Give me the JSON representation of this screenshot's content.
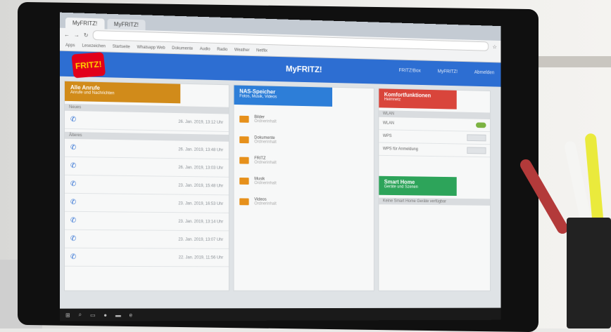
{
  "browser": {
    "tabs": [
      "MyFRITZ!",
      "MyFRITZ!"
    ],
    "bookmarks": [
      "Apps",
      "Lesezeichen",
      "Startseite",
      "Whatsapp Web",
      "Dokumente",
      "Audio",
      "Radio",
      "Weather",
      "Netflix"
    ]
  },
  "header": {
    "logo_text": "FRITZ!",
    "title": "MyFRITZ!",
    "nav": [
      "FRITZ!Box",
      "MyFRITZ!",
      "Abmelden"
    ]
  },
  "calls": {
    "title": "Alle Anrufe",
    "subtitle": "Anrufe und Nachrichten",
    "section_new": "Neues",
    "section_old": "Älteres",
    "items": [
      {
        "date": "26. Jan. 2019, 13:12 Uhr"
      },
      {
        "date": "26. Jan. 2019, 13:48 Uhr"
      },
      {
        "date": "26. Jan. 2019, 13:03 Uhr"
      },
      {
        "date": "23. Jan. 2019, 15:48 Uhr"
      },
      {
        "date": "23. Jan. 2019, 16:53 Uhr"
      },
      {
        "date": "23. Jan. 2019, 13:14 Uhr"
      },
      {
        "date": "23. Jan. 2019, 13:07 Uhr"
      },
      {
        "date": "22. Jan. 2019, 11:56 Uhr"
      }
    ]
  },
  "nas": {
    "title": "NAS-Speicher",
    "subtitle": "Fotos, Musik, Videos",
    "folders": [
      "Bilder",
      "Dokumente",
      "FRITZ",
      "Musik",
      "Videos"
    ],
    "folder_sub": "Ordnerinhalt"
  },
  "home": {
    "title": "Komfortfunktionen",
    "subtitle": "Heimnetz",
    "section": "WLAN",
    "rows": [
      "WLAN",
      "WPS",
      "WPS für Anmeldung"
    ],
    "smart_title": "Smart Home",
    "smart_subtitle": "Geräte und Szenen",
    "smart_note": "Keine Smart Home Geräte verfügbar"
  },
  "colors": {
    "calls_header": "#d18b1a",
    "nas_header": "#2d7ed8",
    "home_header": "#d9453b",
    "smart_header": "#2da45a",
    "brand_blue": "#2d6ed2"
  }
}
